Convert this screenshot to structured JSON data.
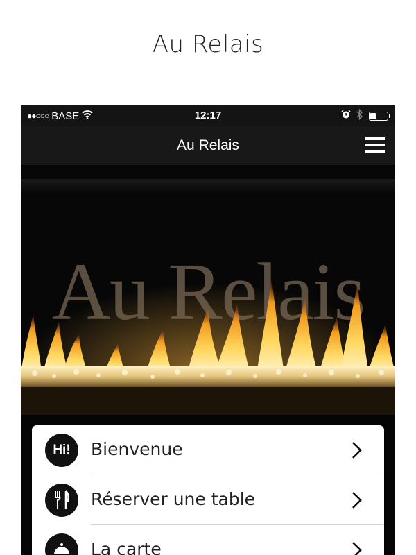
{
  "page": {
    "title": "Au Relais"
  },
  "status_bar": {
    "signal": "●●○○○",
    "carrier": "BASE",
    "time": "12:17"
  },
  "nav": {
    "title": "Au Relais"
  },
  "hero": {
    "sign_text": "Au Relais"
  },
  "menu": {
    "items": [
      {
        "label": "Bienvenue",
        "icon": "hi-icon",
        "icon_text": "Hi!"
      },
      {
        "label": "Réserver une table",
        "icon": "cutlery-icon"
      },
      {
        "label": "La carte",
        "icon": "cloche-icon"
      }
    ]
  },
  "colors": {
    "bar_background": "#141414",
    "menu_background": "#ffffff",
    "icon_background": "#111111"
  }
}
